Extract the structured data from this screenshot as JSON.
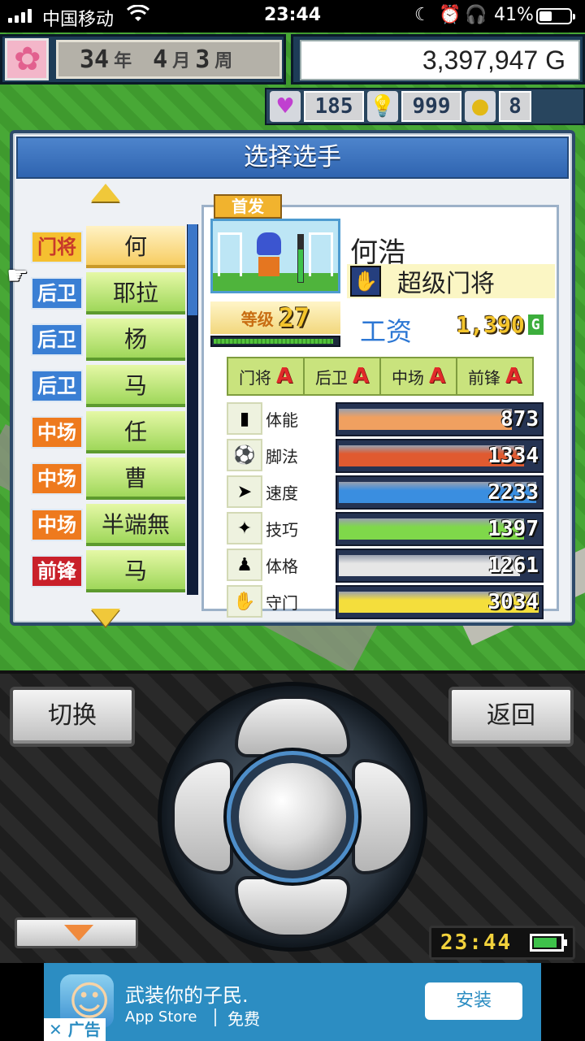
{
  "status_bar": {
    "carrier": "中国移动",
    "time": "23:44",
    "battery_percent": "41%",
    "icons": [
      "signal-icon",
      "wifi-icon",
      "moon-icon",
      "alarm-icon",
      "headphone-icon",
      "battery-icon"
    ]
  },
  "hud": {
    "year_num": "34",
    "year_unit": "年",
    "month_num": "4",
    "month_unit": "月",
    "week_num": "3",
    "week_unit": "周",
    "money": "3,397,947 G",
    "hearts": "185",
    "ideas": "999",
    "coins": "8"
  },
  "dialog": {
    "title": "选择选手",
    "players": [
      {
        "position": "门将",
        "name": "何",
        "type": "gk",
        "selected": true
      },
      {
        "position": "后卫",
        "name": "耶拉",
        "type": "df"
      },
      {
        "position": "后卫",
        "name": "杨",
        "type": "df"
      },
      {
        "position": "后卫",
        "name": "马",
        "type": "df"
      },
      {
        "position": "中场",
        "name": "任",
        "type": "mf"
      },
      {
        "position": "中场",
        "name": "曹",
        "type": "mf"
      },
      {
        "position": "中场",
        "name": "半端無",
        "type": "mf"
      },
      {
        "position": "前锋",
        "name": "马",
        "type": "fw"
      }
    ]
  },
  "detail": {
    "tag": "首发",
    "name": "何浩",
    "role": "超级门将",
    "level_label": "等级",
    "level": "27",
    "exp_fraction": 0.97,
    "salary_label": "工资",
    "salary": "1,390",
    "salary_unit": "G",
    "aptitudes": [
      {
        "label": "门将",
        "grade": "A"
      },
      {
        "label": "后卫",
        "grade": "A"
      },
      {
        "label": "中场",
        "grade": "A"
      },
      {
        "label": "前锋",
        "grade": "A"
      }
    ],
    "stats": [
      {
        "label": "体能",
        "value": "873",
        "fill": 0.86,
        "color": "#f0a060",
        "icon": "stamina-icon",
        "glyph": "▮"
      },
      {
        "label": "脚法",
        "value": "1334",
        "fill": 0.92,
        "color": "#e05a30",
        "icon": "kick-icon",
        "glyph": "⚽"
      },
      {
        "label": "速度",
        "value": "2233",
        "fill": 0.98,
        "color": "#3a8ee0",
        "icon": "speed-icon",
        "glyph": "➤"
      },
      {
        "label": "技巧",
        "value": "1397",
        "fill": 0.92,
        "color": "#7fd84a",
        "icon": "skill-icon",
        "glyph": "✦"
      },
      {
        "label": "体格",
        "value": "1261",
        "fill": 0.9,
        "color": "#e6e6e6",
        "icon": "physique-icon",
        "glyph": "♟"
      },
      {
        "label": "守门",
        "value": "3034",
        "fill": 0.99,
        "color": "#f4de3c",
        "icon": "goalkeeping-icon",
        "glyph": "✋"
      }
    ]
  },
  "controller": {
    "switch_label": "切换",
    "back_label": "返回",
    "clock": "23:44"
  },
  "ad": {
    "headline": "武装你的子民.",
    "store": "App Store",
    "price": "免费",
    "install": "安装",
    "label": "✕ 广告"
  }
}
